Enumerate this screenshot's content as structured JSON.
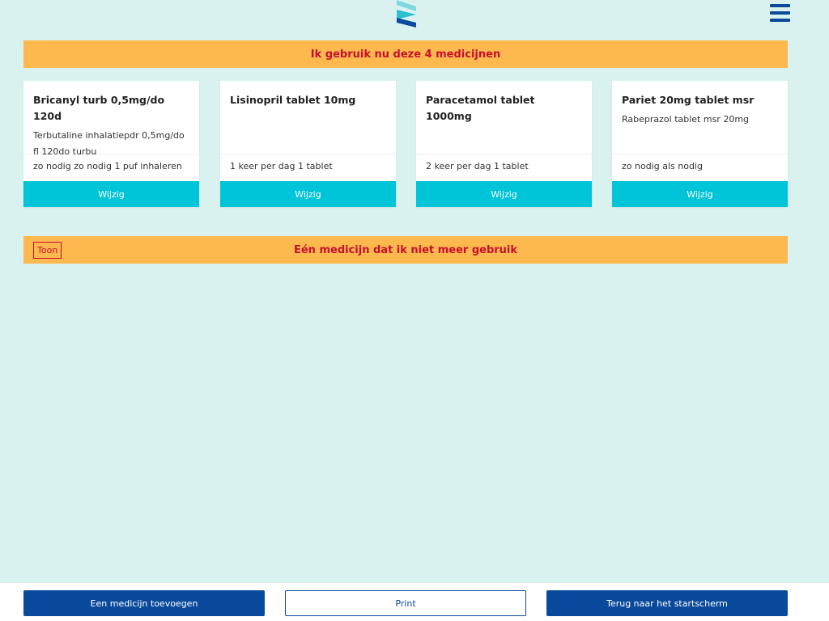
{
  "header": {
    "logo_icon": "brand-logo-icon",
    "menu_icon": "hamburger-menu-icon"
  },
  "current_section": {
    "title": "Ik gebruik nu deze 4 medicijnen",
    "medications": [
      {
        "name": "Bricanyl turb 0,5mg/do 120d",
        "description": "Terbutaline inhalatiepdr 0,5mg/do fl 120do turbu",
        "dosage": "zo nodig zo nodig 1 puf inhaleren",
        "button_label": "Wijzig"
      },
      {
        "name": "Lisinopril tablet 10mg",
        "description": "",
        "dosage": "1 keer per dag 1 tablet",
        "button_label": "Wijzig"
      },
      {
        "name": "Paracetamol tablet 1000mg",
        "description": "",
        "dosage": "2 keer per dag 1 tablet",
        "button_label": "Wijzig"
      },
      {
        "name": "Pariet 20mg tablet msr",
        "description": "Rabeprazol tablet msr 20mg",
        "dosage": "zo nodig als nodig",
        "button_label": "Wijzig"
      }
    ]
  },
  "stopped_section": {
    "title": "Eén medicijn dat ik niet meer gebruik",
    "toggle_label": "Toon"
  },
  "footer": {
    "add_label": "Een medicijn toevoegen",
    "print_label": "Print",
    "back_label": "Terug naar het startscherm"
  },
  "colors": {
    "background": "#d9f2f0",
    "banner": "#fdb84e",
    "banner_text": "#c8102e",
    "card_button": "#00c4d8",
    "primary": "#0a4a9c"
  }
}
